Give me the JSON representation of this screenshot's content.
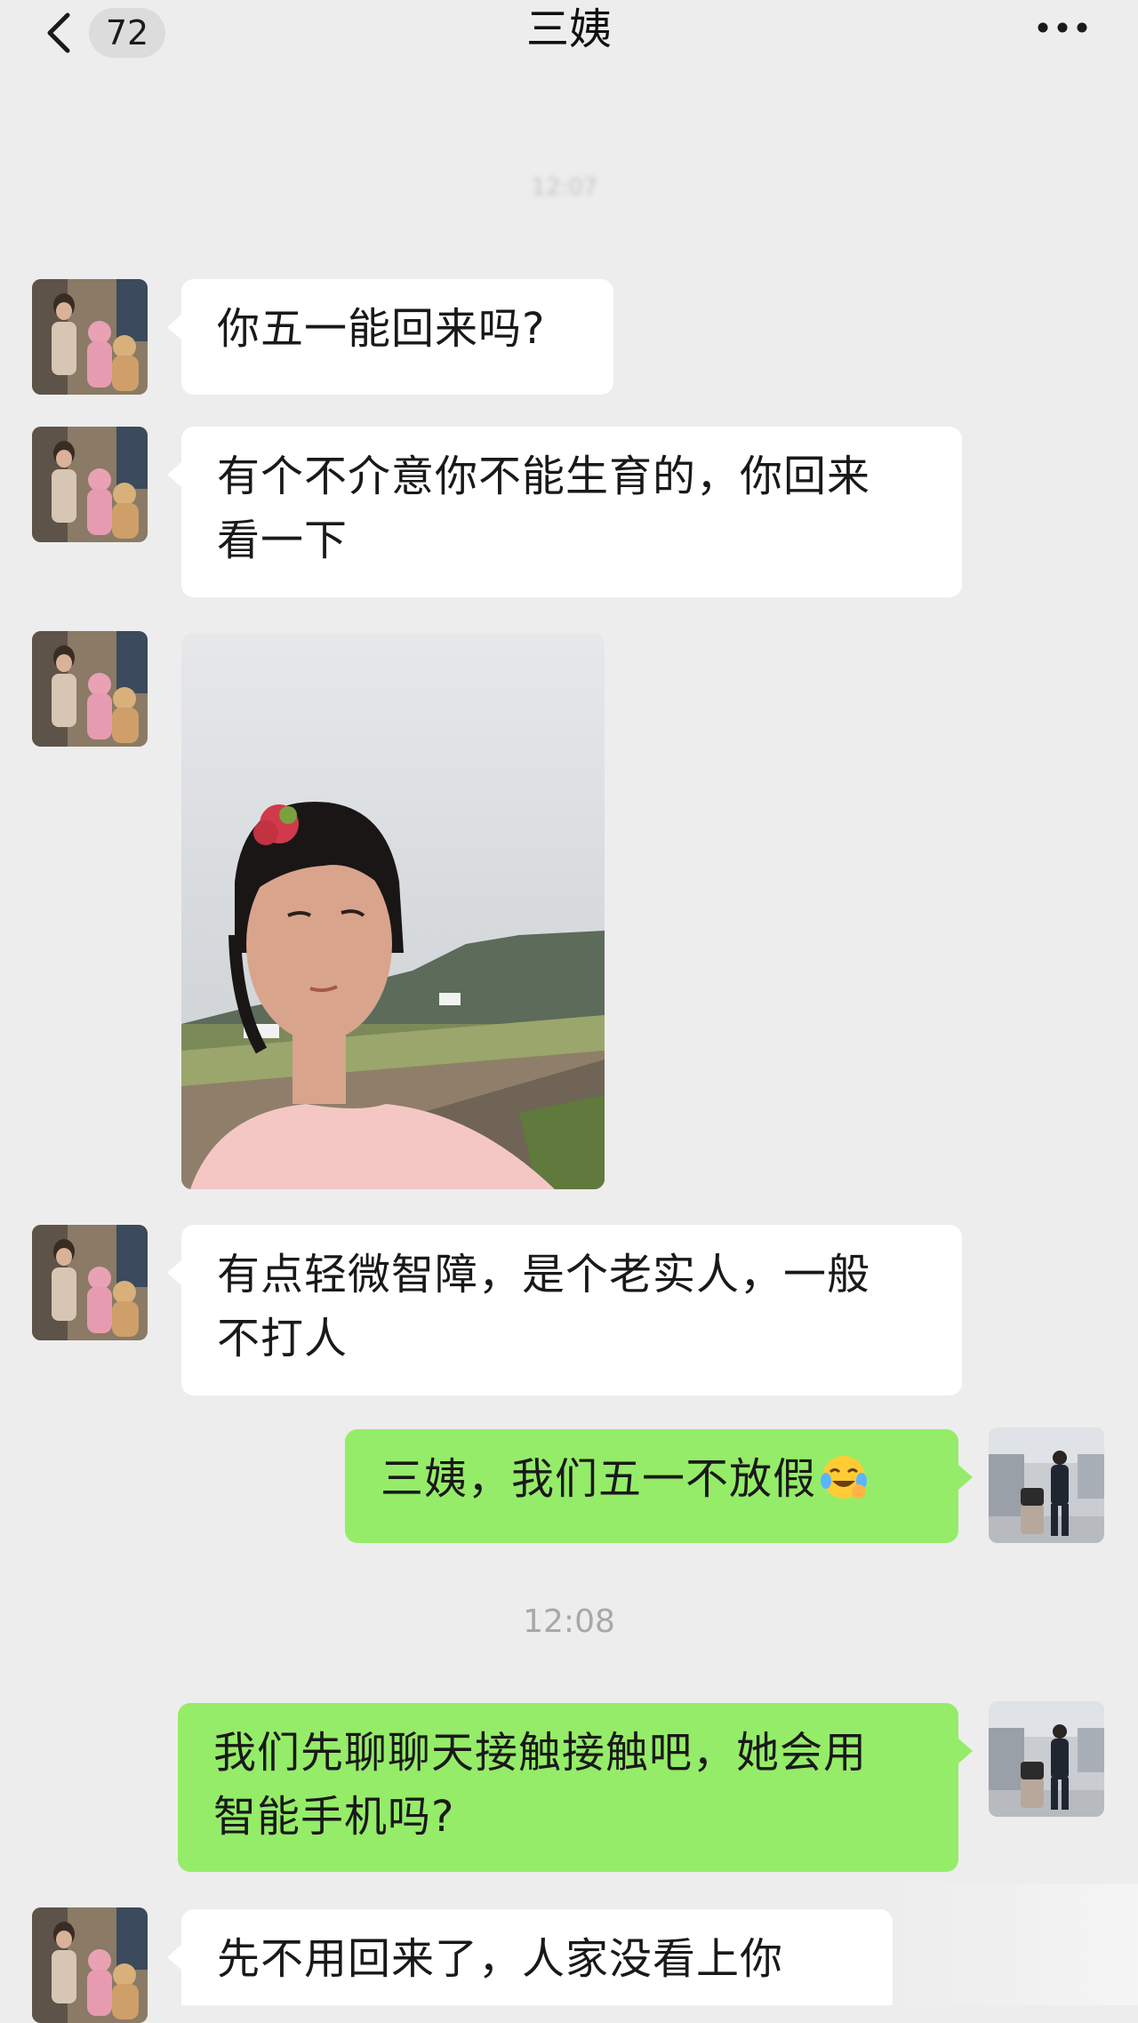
{
  "header": {
    "unread_count": "72",
    "title": "三姨",
    "back_icon": "chevron-left-icon",
    "more_icon": "more-dots-icon"
  },
  "faint_timestamp": "12:07",
  "messages": [
    {
      "sender": "aunt",
      "type": "text",
      "text": "你五一能回来吗?"
    },
    {
      "sender": "aunt",
      "type": "text",
      "lines": [
        "有个不介意你不能生育的，你回来",
        "看一下"
      ]
    },
    {
      "sender": "aunt",
      "type": "image",
      "description_icon": "photo-icon"
    },
    {
      "sender": "aunt",
      "type": "text",
      "lines": [
        "有点轻微智障，是个老实人，一般",
        "不打人"
      ]
    },
    {
      "sender": "me",
      "type": "text",
      "text": "三姨，我们五一不放假",
      "emoji": "crying-laughing-emoji-icon"
    },
    {
      "sender": "me",
      "type": "text",
      "lines": [
        "我们先聊聊天接触接触吧，她会用",
        "智能手机吗?"
      ]
    },
    {
      "sender": "aunt",
      "type": "text",
      "text": "先不用回来了，人家没看上你"
    }
  ],
  "time_divider": "12:08",
  "colors": {
    "background": "#ededed",
    "incoming_bubble": "#ffffff",
    "outgoing_bubble": "#95ec69",
    "text": "#191919",
    "timestamp": "#a8a8a8"
  }
}
